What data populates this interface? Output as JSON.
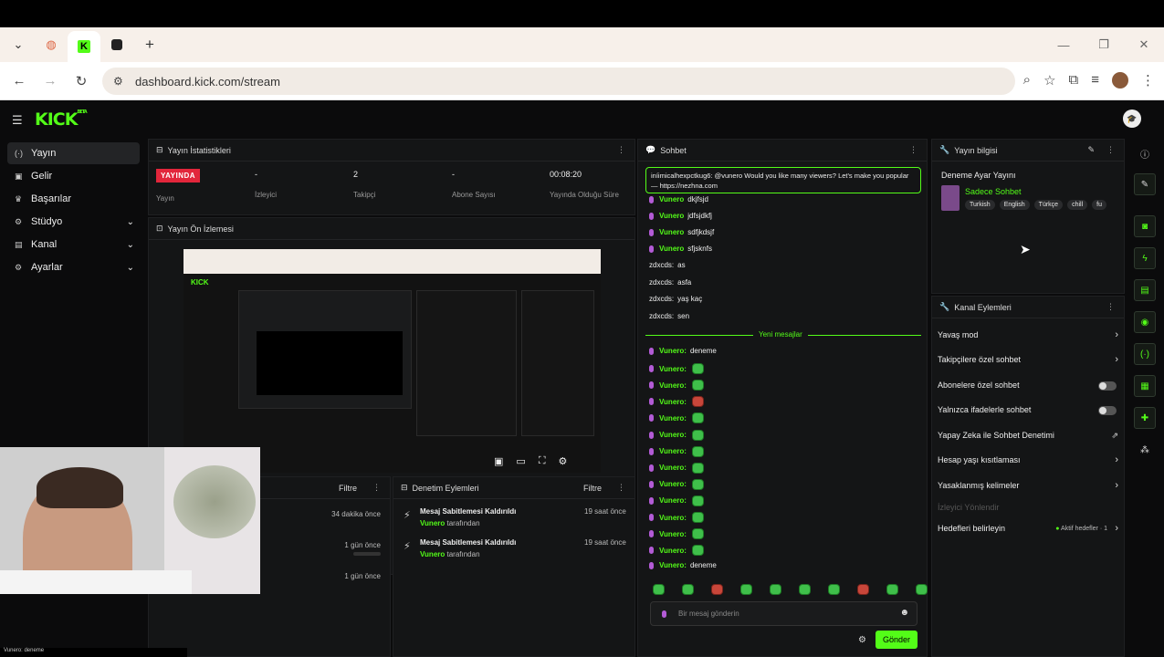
{
  "browser": {
    "url": "dashboard.kick.com/stream"
  },
  "header": {
    "logo": "KICK",
    "logo_tag": "BETA",
    "user_initials": "🎓"
  },
  "sidebar": {
    "items": [
      {
        "label": "Yayın",
        "icon": "live-icon"
      },
      {
        "label": "Gelir",
        "icon": "revenue-icon"
      },
      {
        "label": "Başarılar",
        "icon": "trophy-icon"
      },
      {
        "label": "Stüdyo",
        "icon": "studio-icon"
      },
      {
        "label": "Kanal",
        "icon": "channel-icon"
      },
      {
        "label": "Ayarlar",
        "icon": "settings-icon"
      }
    ]
  },
  "stats": {
    "title": "Yayın İstatistikleri",
    "live_badge": "YAYINDA",
    "live_label": "Yayın",
    "viewers": "-",
    "viewers_label": "İzleyici",
    "followers": "2",
    "followers_label": "Takipçi",
    "subs": "-",
    "subs_label": "Abone Sayısı",
    "uptime": "00:08:20",
    "uptime_label": "Yayında Olduğu Süre"
  },
  "preview": {
    "title": "Yayın Ön İzlemesi"
  },
  "activity": {
    "filter": "Filtre",
    "times": [
      "34 dakika önce",
      "1 gün önce",
      "1 gün önce"
    ]
  },
  "moderation": {
    "title": "Denetim Eylemleri",
    "filter": "Filtre",
    "items": [
      {
        "text": "Mesaj Sabitlemesi Kaldırıldı",
        "by_user": "Vunero",
        "by_suffix": "tarafından",
        "time": "19 saat önce"
      },
      {
        "text": "Mesaj Sabitlemesi Kaldırıldı",
        "by_user": "Vunero",
        "by_suffix": "tarafından",
        "time": "19 saat önce"
      }
    ]
  },
  "chat": {
    "title": "Sohbet",
    "pinned": "iníimicalhexpctkug6: @vunero Would you like many viewers? Let's make you popular — https://nezhna.com",
    "messages": [
      {
        "user": "Vunero",
        "text": "dkjfsjd"
      },
      {
        "user": "Vunero",
        "text": "jdfsjdkfj"
      },
      {
        "user": "Vunero",
        "text": "sdfjkdsjf"
      },
      {
        "user": "Vunero",
        "text": "sfjsknfs"
      }
    ],
    "plain": [
      {
        "user": "zdxcds:",
        "text": "as"
      },
      {
        "user": "zdxcds:",
        "text": "asfa"
      },
      {
        "user": "zdxcds:",
        "text": "yaş kaç"
      },
      {
        "user": "zdxcds:",
        "text": "sen"
      }
    ],
    "new_messages": "Yeni mesajlar",
    "after": [
      {
        "user": "Vunero:",
        "text": "deneme"
      },
      {
        "user": "Vunero:",
        "text": ""
      },
      {
        "user": "Vunero:",
        "text": ""
      },
      {
        "user": "Vunero:",
        "text": ""
      },
      {
        "user": "Vunero:",
        "text": ""
      },
      {
        "user": "Vunero:",
        "text": ""
      },
      {
        "user": "Vunero:",
        "text": ""
      },
      {
        "user": "Vunero:",
        "text": ""
      },
      {
        "user": "Vunero:",
        "text": ""
      },
      {
        "user": "Vunero:",
        "text": ""
      },
      {
        "user": "Vunero:",
        "text": ""
      },
      {
        "user": "Vunero:",
        "text": ""
      },
      {
        "user": "Vunero:",
        "text": ""
      },
      {
        "user": "Vunero:",
        "text": "deneme"
      }
    ],
    "input_placeholder": "Bir mesaj gönderin",
    "send": "Gönder"
  },
  "stream_info": {
    "title": "Yayın bilgisi",
    "stream_title": "Deneme Ayar Yayını",
    "category": "Sadece Sohbet",
    "tags": [
      "Turkish",
      "English",
      "Türkçe",
      "chill",
      "fu"
    ]
  },
  "channel_actions": {
    "title": "Kanal Eylemleri",
    "items": [
      {
        "label": "Yavaş mod",
        "control": "arrow"
      },
      {
        "label": "Takipçilere özel sohbet",
        "control": "arrow"
      },
      {
        "label": "Abonelere özel sohbet",
        "control": "toggle"
      },
      {
        "label": "Yalnızca ifadelerle sohbet",
        "control": "toggle"
      },
      {
        "label": "Yapay Zeka ile Sohbet Denetimi",
        "control": "external"
      },
      {
        "label": "Hesap yaşı kısıtlaması",
        "control": "arrow"
      },
      {
        "label": "Yasaklanmış kelimeler",
        "control": "arrow"
      }
    ],
    "disabled": "İzleyici Yönlendir",
    "goals": "Hedefleri belirleyin",
    "goals_status": "Aktif hedefler · 1"
  },
  "footer": {
    "chat_line": "Vunero: deneme"
  }
}
